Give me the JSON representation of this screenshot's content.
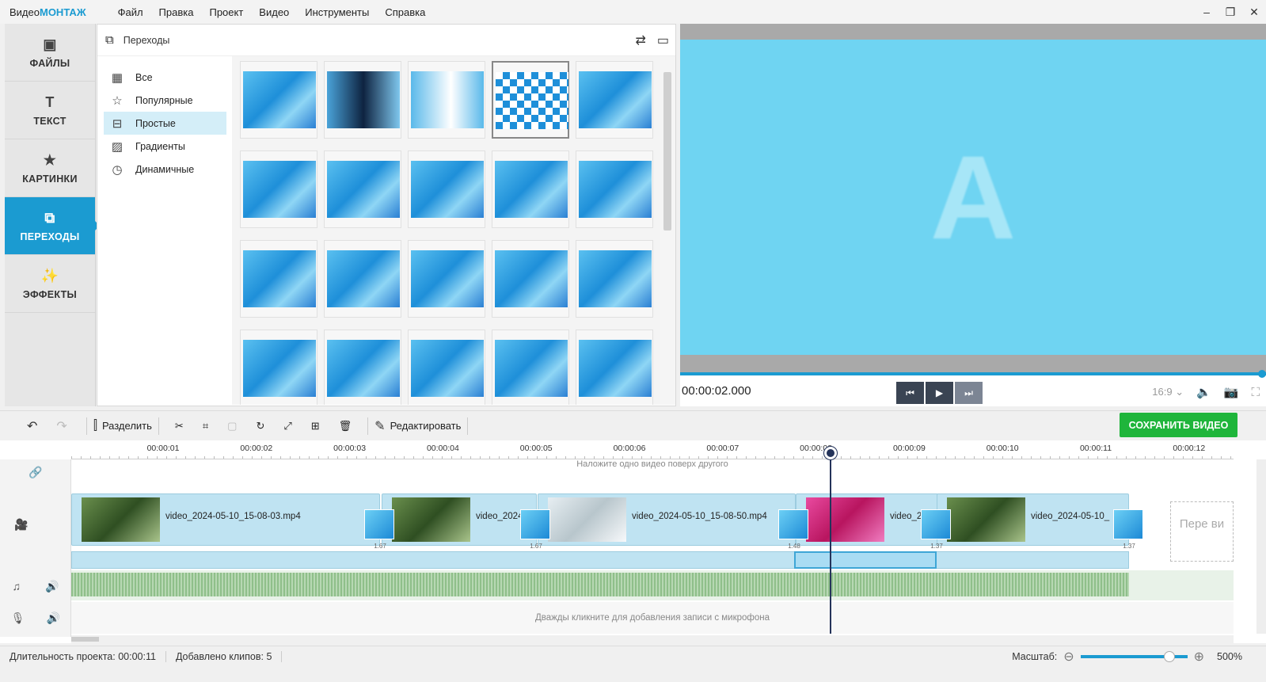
{
  "app": {
    "logo_prefix": "Видео",
    "logo_brand": "МОНТАЖ"
  },
  "menu": [
    "Файл",
    "Правка",
    "Проект",
    "Видео",
    "Инструменты",
    "Справка"
  ],
  "window": {
    "minimize": "–",
    "restore": "❐",
    "close": "✕"
  },
  "nav": [
    {
      "label": "ФАЙЛЫ",
      "icon": "image-icon",
      "glyph": "▣"
    },
    {
      "label": "ТЕКСТ",
      "icon": "text-icon",
      "glyph": "T"
    },
    {
      "label": "КАРТИНКИ",
      "icon": "star-icon",
      "glyph": "★"
    },
    {
      "label": "ПЕРЕХОДЫ",
      "icon": "transitions-icon",
      "glyph": "⧉",
      "active": true
    },
    {
      "label": "ЭФФЕКТЫ",
      "icon": "magic-wand-icon",
      "glyph": "✨"
    }
  ],
  "panel": {
    "title": "Переходы",
    "shuffle_glyph": "⇄",
    "frame_glyph": "▭"
  },
  "categories": [
    {
      "label": "Все",
      "glyph": "▦"
    },
    {
      "label": "Популярные",
      "glyph": "☆"
    },
    {
      "label": "Простые",
      "glyph": "⊟",
      "active": true
    },
    {
      "label": "Градиенты",
      "glyph": "▨"
    },
    {
      "label": "Динамичные",
      "glyph": "◷"
    }
  ],
  "preview": {
    "letter": "A",
    "time": "00:00:02.000",
    "aspect": "16:9 ⌄",
    "play_prev": "⏮",
    "play": "▶",
    "play_next": "⏭"
  },
  "toolbar": {
    "undo": "↶",
    "redo": "↷",
    "split_label": "Разделить",
    "edit_label": "Редактировать",
    "save_label": "СОХРАНИТЬ ВИДЕО"
  },
  "ruler": [
    "00:00:01",
    "00:00:02",
    "00:00:03",
    "00:00:04",
    "00:00:05",
    "00:00:06",
    "00:00:07",
    "00:00:08",
    "00:00:09",
    "00:00:10",
    "00:00:11",
    "00:00:12"
  ],
  "timeline": {
    "overlay_hint": "Наложите одно видео поверх другого",
    "mic_hint": "Дважды кликните для добавления записи с микрофона",
    "ghost_label": "Пере ви"
  },
  "clips": [
    {
      "name": "video_2024-05-10_15-08-03.mp4"
    },
    {
      "name": "video_2024-"
    },
    {
      "name": "video_2024-05-10_15-08-50.mp4"
    },
    {
      "name": "video_2"
    },
    {
      "name": "video_2024-05-10_"
    }
  ],
  "transitions_durations": [
    "1.67",
    "1.67",
    "1.48",
    "1.37",
    "1.37"
  ],
  "status": {
    "duration_label": "Длительность проекта:",
    "duration_value": "00:00:11",
    "clips_label": "Добавлено клипов: 5",
    "zoom_label": "Масштаб:",
    "zoom_value": "500%",
    "zoom_minus": "⊖",
    "zoom_plus": "⊕"
  }
}
